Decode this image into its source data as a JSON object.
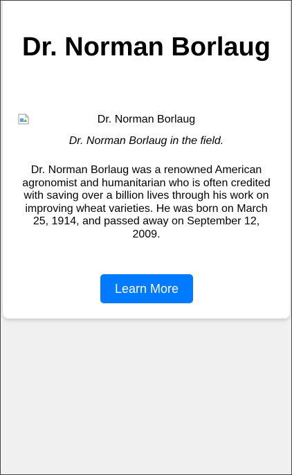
{
  "card": {
    "title": "Dr. Norman Borlaug",
    "image": {
      "alt": "Dr. Norman Borlaug",
      "icon": "broken-image-icon"
    },
    "caption": "Dr. Norman Borlaug in the field.",
    "bio": "Dr. Norman Borlaug was a renowned American agronomist and humanitarian who is often credited with saving over a billion lives through his work on improving wheat varieties. He was born on March 25, 1914, and passed away on September 12, 2009.",
    "button_label": "Learn More"
  },
  "colors": {
    "page_background": "#f0f0f0",
    "card_background": "#ffffff",
    "button_background": "#007bff",
    "button_text": "#ffffff",
    "text": "#000000"
  }
}
